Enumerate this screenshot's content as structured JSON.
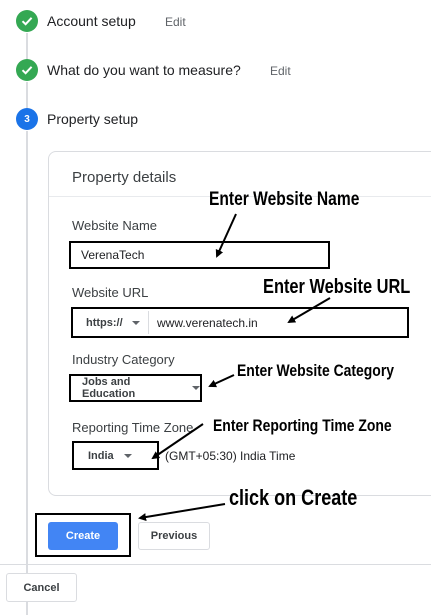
{
  "steps": [
    {
      "title": "Account setup",
      "edit": "Edit",
      "status": "done",
      "icon": "check-icon"
    },
    {
      "title": "What do you want to measure?",
      "edit": "Edit",
      "status": "done",
      "icon": "check-icon"
    },
    {
      "title": "Property setup",
      "number": "3",
      "status": "current"
    }
  ],
  "card": {
    "title": "Property details",
    "website_name": {
      "label": "Website Name",
      "value": "VerenaTech"
    },
    "website_url": {
      "label": "Website URL",
      "protocol": "https://",
      "value": "www.verenatech.in"
    },
    "industry": {
      "label": "Industry Category",
      "value": "Jobs and Education"
    },
    "timezone": {
      "label": "Reporting Time Zone",
      "country": "India",
      "zone": "(GMT+05:30) India Time"
    }
  },
  "annotations": {
    "name": "Enter Website Name",
    "url": "Enter Website URL",
    "category": "Enter Website Category",
    "timezone": "Enter Reporting Time Zone",
    "create": "click on Create"
  },
  "buttons": {
    "create": "Create",
    "previous": "Previous",
    "cancel": "Cancel"
  },
  "colors": {
    "check": "#34a853",
    "current_step": "#1a73e8",
    "primary_button": "#4285f4"
  }
}
